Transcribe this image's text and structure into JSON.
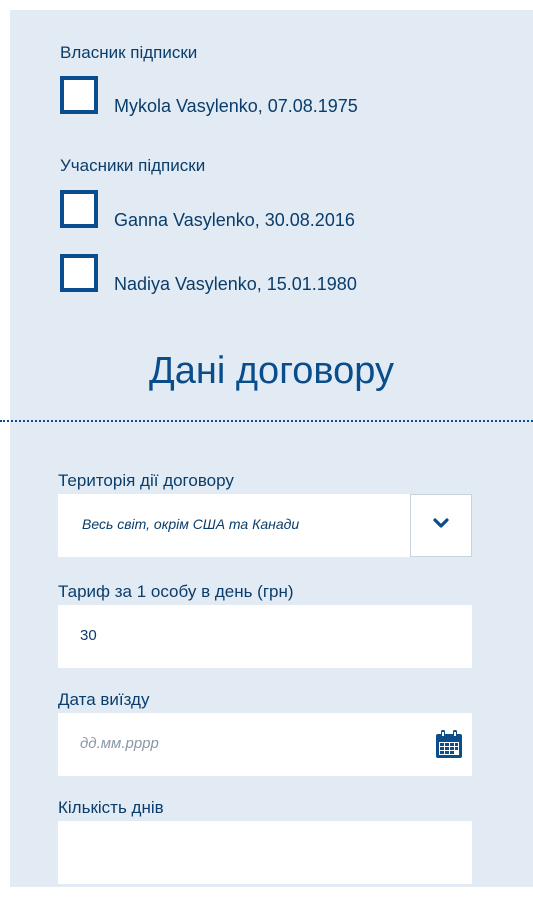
{
  "subscription": {
    "owner_label": "Власник підписки",
    "owner": {
      "name": "Mykola Vasylenko, 07.08.1975",
      "checked": false
    },
    "participants_label": "Учасники підписки",
    "participants": [
      {
        "name": "Ganna Vasylenko, 30.08.2016",
        "checked": false
      },
      {
        "name": "Nadiya Vasylenko, 15.01.1980",
        "checked": false
      }
    ]
  },
  "contract": {
    "heading": "Дані договору",
    "territory": {
      "label": "Територія дії договору",
      "value": "Весь світ, окрім США та Канади",
      "button_icon": "chevron-down-icon"
    },
    "tariff": {
      "label": "Тариф за 1 особу в день (грн)",
      "value": "30"
    },
    "departure_date": {
      "label": "Дата виїзду",
      "placeholder": "дд.мм.рррр",
      "button_icon": "calendar-icon"
    },
    "days": {
      "label": "Кількість днів",
      "value": ""
    }
  },
  "colors": {
    "panel_background": "#e2ebf4",
    "primary_blue": "#0a4d8c",
    "text_dark_blue": "#0a3d6b",
    "placeholder_gray": "#8a98a8",
    "field_background": "#ffffff"
  }
}
